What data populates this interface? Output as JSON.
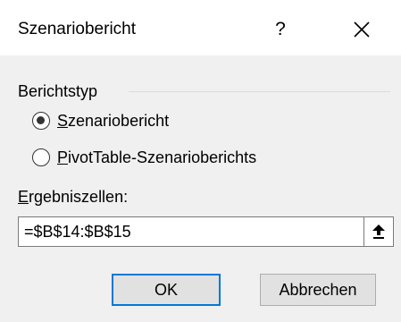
{
  "dialog": {
    "title": "Szenariobericht",
    "help_label": "?",
    "close_label": "Schließen"
  },
  "report_type": {
    "label": "Berichtstyp",
    "options": [
      {
        "mnemonic": "S",
        "rest": "zenariobericht",
        "checked": true
      },
      {
        "mnemonic": "P",
        "rest": "ivotTable-Szenarioberichts",
        "checked": false
      }
    ]
  },
  "result_cells": {
    "mnemonic": "E",
    "rest": "rgebniszellen:",
    "value": "=$B$14:$B$15"
  },
  "buttons": {
    "ok": "OK",
    "cancel": "Abbrechen"
  },
  "colors": {
    "accent": "#0078d7",
    "background": "#f0f0f0"
  }
}
